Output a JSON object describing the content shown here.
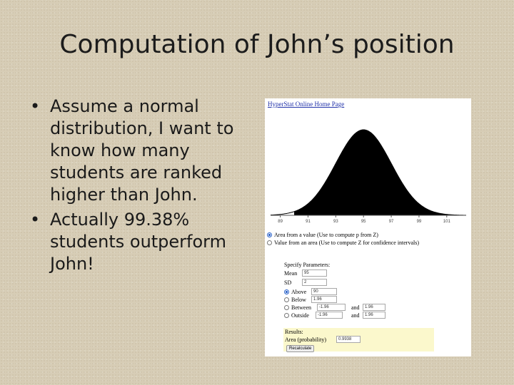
{
  "slide": {
    "title": "Computation of John’s position",
    "bullets": [
      "Assume a normal distribution, I want to know how many students are ranked higher than John.",
      "Actually 99.38% students outperform John!"
    ]
  },
  "calculator": {
    "home_link": "HyperStat Online Home Page",
    "axis_ticks": [
      "89",
      "91",
      "93",
      "95",
      "97",
      "99",
      "101"
    ],
    "modes": {
      "area_from_value": "Area from a value (Use to compute p from Z)",
      "value_from_area": "Value from an area (Use to compute Z for confidence intervals)",
      "selected": "area_from_value"
    },
    "params": {
      "header": "Specify Parameters:",
      "mean_label": "Mean",
      "mean_value": "95",
      "sd_label": "SD",
      "sd_value": "2",
      "above_label": "Above",
      "above_value": "90",
      "below_label": "Below",
      "below_value": "1.96",
      "between_label": "Between",
      "between_from": "-1.96",
      "between_and": "and",
      "between_to": "1.96",
      "outside_label": "Outside",
      "outside_from": "-1.96",
      "outside_and": "and",
      "outside_to": "1.96",
      "selected": "above"
    },
    "results": {
      "header": "Results:",
      "area_label": "Area (probability)",
      "area_value": "0.9938",
      "button": "Recalculate"
    },
    "shaded_from": 90
  },
  "colors": {
    "background": "#d7cdb6",
    "link": "#2233aa",
    "radio_selected": "#2a62c9",
    "results_bg": "#fbf8cc",
    "curve_fill": "#000000"
  }
}
